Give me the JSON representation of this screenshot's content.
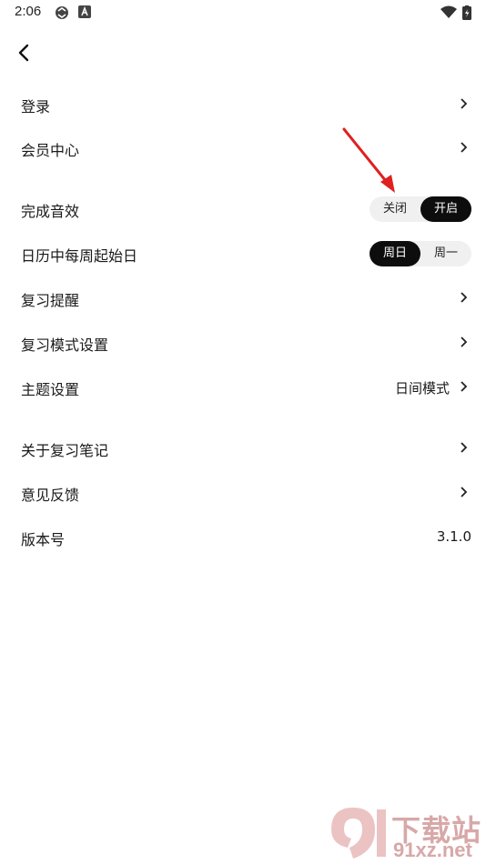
{
  "status_bar": {
    "time": "2:06"
  },
  "settings": {
    "login": {
      "label": "登录"
    },
    "member_center": {
      "label": "会员中心"
    },
    "complete_sound": {
      "label": "完成音效",
      "options": [
        "关闭",
        "开启"
      ],
      "selected": "开启"
    },
    "week_start": {
      "label": "日历中每周起始日",
      "options": [
        "周日",
        "周一"
      ],
      "selected": "周日"
    },
    "review_reminder": {
      "label": "复习提醒"
    },
    "review_mode": {
      "label": "复习模式设置"
    },
    "theme": {
      "label": "主题设置",
      "value": "日间模式"
    },
    "about": {
      "label": "关于复习笔记"
    },
    "feedback": {
      "label": "意见反馈"
    },
    "version": {
      "label": "版本号",
      "value": "3.1.0"
    }
  },
  "watermark": {
    "line1": "下载站",
    "line2": "91xz.net"
  },
  "colors": {
    "active_segment": "#0d0d0d",
    "inactive_segment": "#f0f0f0",
    "arrow": "#e02020",
    "watermark": "#d8a8a8"
  }
}
